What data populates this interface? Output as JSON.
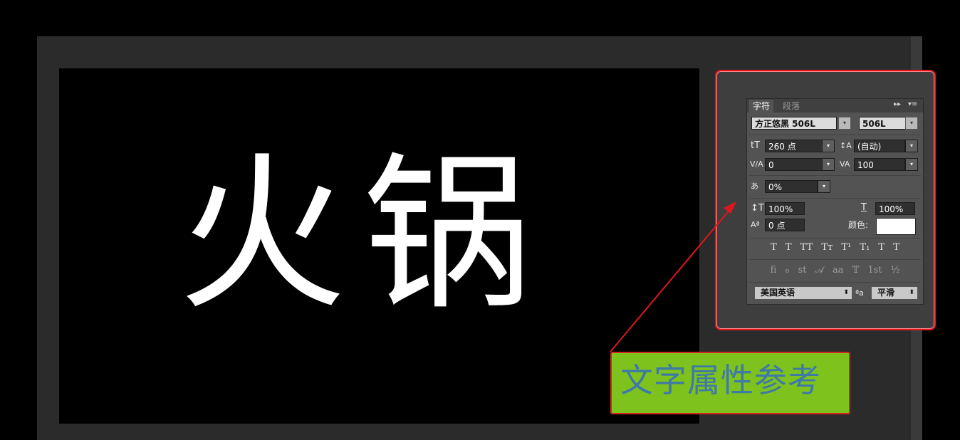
{
  "canvas": {
    "text": "火锅"
  },
  "panel": {
    "tabs": [
      "字符",
      "段落"
    ],
    "controls": {
      "collapse": "▸▸",
      "menu": "▾≡"
    },
    "font_family": "方正悠黑 506L",
    "font_style": "506L",
    "font_size": "260 点",
    "leading": "(自动)",
    "kerning": "0",
    "tracking": "100",
    "tsume": "0%",
    "vertical_scale": "100%",
    "horizontal_scale": "100%",
    "baseline_shift": "0 点",
    "color_label": "颜色:",
    "color_value": "#ffffff",
    "style_buttons": "T T TT Tт T¹ T₁ T T",
    "opentype_buttons": "fi ℴ st 𝒜 aa 𝕋 1st ½",
    "language": "美国英语",
    "aa_label": "ªa",
    "antialias": "平滑",
    "icons": {
      "size": "tT",
      "leading": "↕A",
      "kerning": "V/A",
      "tracking": "VA",
      "tsume": "あ",
      "vscale": "↕T",
      "hscale": "T",
      "baseline": "Aª"
    }
  },
  "annotation": {
    "label": "文字属性参考",
    "bg": "#7ec31d",
    "border": "#d4261f",
    "text_color": "#3f79a6",
    "arrow_color": "#e0161c"
  }
}
